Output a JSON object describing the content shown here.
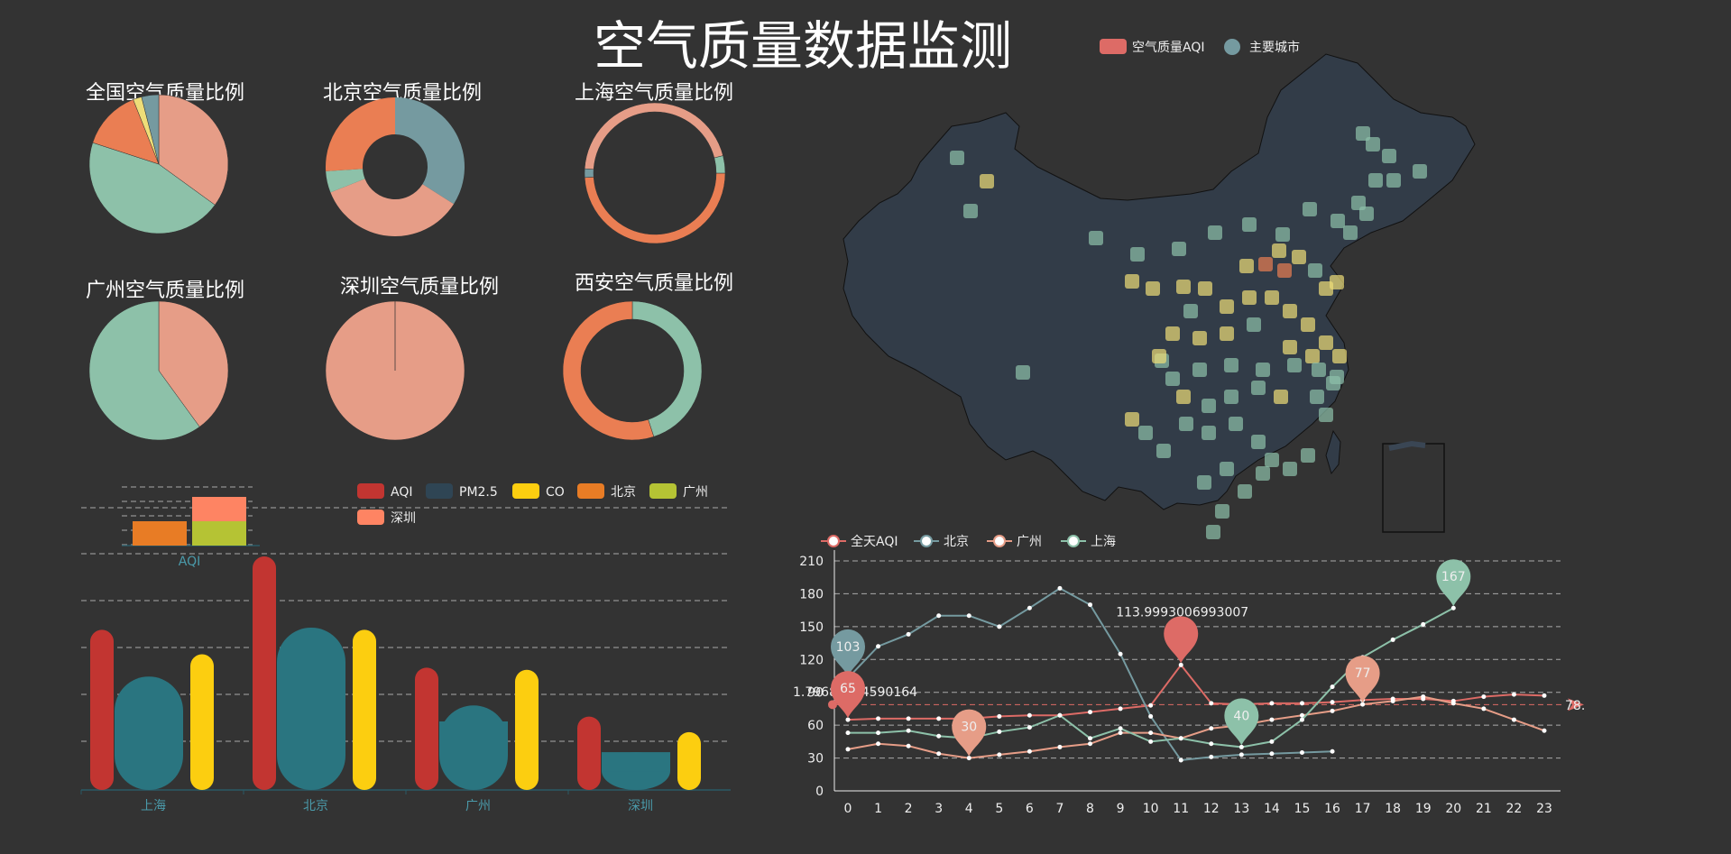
{
  "title": "空气质量数据监测",
  "colors": {
    "aqi": "#c23531",
    "pm25": "#2f4554",
    "co": "#fcce10",
    "beijing": "#e87c25",
    "guangzhou": "#b5c334",
    "shenzhen": "#fe8463",
    "salmon": "#e69d87",
    "teal": "#759aa0",
    "green": "#8dc1a9",
    "orange": "#ea7e53",
    "yellow": "#eedd78"
  },
  "map": {
    "legend": [
      "空气质量AQI",
      "主要城市"
    ],
    "legend_colors": [
      "#dd6b66",
      "#759aa0"
    ]
  },
  "chart_data": [
    {
      "type": "pie",
      "title": "全国空气质量比例",
      "variant": "pie",
      "values": [
        35,
        45,
        14,
        2,
        4
      ],
      "colors": [
        "#e69d87",
        "#8dc1a9",
        "#ea7e53",
        "#eedd78",
        "#759aa0"
      ]
    },
    {
      "type": "pie",
      "title": "北京空气质量比例",
      "variant": "ring",
      "values": [
        34,
        35,
        5,
        26
      ],
      "colors": [
        "#759aa0",
        "#e69d87",
        "#8dc1a9",
        "#ea7e53"
      ]
    },
    {
      "type": "pie",
      "title": "上海空气质量比例",
      "variant": "semi",
      "values": [
        49,
        2,
        45,
        4
      ],
      "colors": [
        "#ea7e53",
        "#759aa0",
        "#e69d87",
        "#8dc1a9"
      ]
    },
    {
      "type": "pie",
      "title": "广州空气质量比例",
      "variant": "pie",
      "values": [
        40,
        60
      ],
      "colors": [
        "#e69d87",
        "#8dc1a9"
      ]
    },
    {
      "type": "pie",
      "title": "深圳空气质量比例",
      "variant": "pie",
      "values": [
        100
      ],
      "colors": [
        "#e69d87"
      ]
    },
    {
      "type": "pie",
      "title": "西安空气质量比例",
      "variant": "thinring",
      "values": [
        45,
        55
      ],
      "colors": [
        "#8dc1a9",
        "#ea7e53"
      ]
    },
    {
      "type": "bar",
      "legend": [
        "AQI",
        "PM2.5",
        "CO",
        "北京",
        "广州",
        "深圳"
      ],
      "legend_colors": [
        "#c23531",
        "#2f4554",
        "#fcce10",
        "#e87c25",
        "#b5c334",
        "#fe8463"
      ],
      "categories": [
        "上海",
        "北京",
        "广州",
        "深圳"
      ],
      "series": [
        {
          "name": "AQI",
          "values": [
            72,
            105,
            55,
            33
          ]
        },
        {
          "name": "PM2.5",
          "values": [
            51,
            73,
            38,
            17
          ]
        },
        {
          "name": "CO",
          "values": [
            61,
            72,
            54,
            26
          ]
        }
      ],
      "inset": {
        "category": "AQI",
        "beijing": 9,
        "guangzhou": 9,
        "shenzhen": 9
      }
    },
    {
      "type": "line",
      "legend": [
        "全天AQI",
        "北京",
        "广州",
        "上海"
      ],
      "x": [
        0,
        1,
        2,
        3,
        4,
        5,
        6,
        7,
        8,
        9,
        10,
        11,
        12,
        13,
        14,
        15,
        16,
        17,
        18,
        19,
        20,
        21,
        22,
        23
      ],
      "yticks": [
        0,
        30,
        60,
        90,
        120,
        150,
        180,
        210
      ],
      "ylim": [
        0,
        210
      ],
      "series": [
        {
          "name": "全天AQI",
          "color": "#dd6b66",
          "values": [
            65,
            66,
            66,
            66,
            66,
            68,
            69,
            69,
            72,
            75,
            78,
            115,
            80,
            79,
            80,
            80,
            81,
            83,
            84,
            84,
            82,
            86,
            88,
            87
          ]
        },
        {
          "name": "北京",
          "color": "#759aa0",
          "values": [
            103,
            132,
            143,
            160,
            160,
            150,
            167,
            185,
            170,
            125,
            68,
            28,
            31,
            33,
            34,
            35,
            36,
            null,
            null,
            null,
            null,
            null,
            null,
            null
          ]
        },
        {
          "name": "广州",
          "color": "#e69d87",
          "values": [
            38,
            43,
            41,
            34,
            30,
            33,
            36,
            40,
            43,
            53,
            53,
            48,
            57,
            60,
            65,
            69,
            73,
            79,
            82,
            86,
            80,
            75,
            65,
            55
          ]
        },
        {
          "name": "上海",
          "color": "#8dc1a9",
          "values": [
            53,
            53,
            55,
            50,
            48,
            54,
            58,
            69,
            48,
            57,
            45,
            48,
            43,
            40,
            45,
            65,
            95,
            122,
            138,
            152,
            167,
            null,
            null,
            null
          ]
        }
      ],
      "markers": [
        {
          "series": "北京",
          "label": "103"
        },
        {
          "series": "全天AQI",
          "label": "113.9993006993007"
        },
        {
          "series": "全天AQI",
          "label": "65"
        },
        {
          "series": "广州",
          "label": "30"
        },
        {
          "series": "上海",
          "label": "40"
        },
        {
          "series": "广州",
          "label": "77"
        },
        {
          "series": "上海",
          "label": "167"
        }
      ],
      "avg_label": "1.79688524590164",
      "avg_right": "78."
    }
  ]
}
